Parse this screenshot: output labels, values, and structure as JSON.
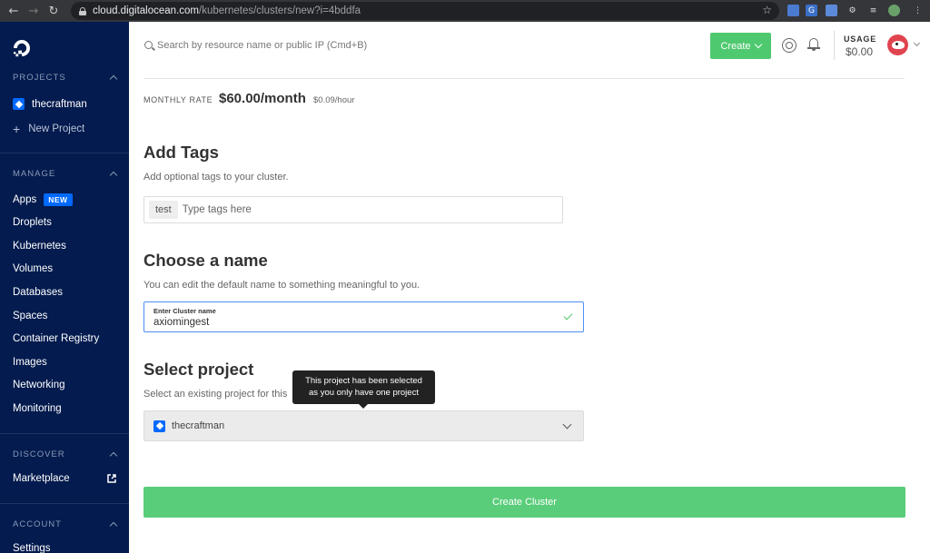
{
  "browser": {
    "url_host": "cloud.digitalocean.com",
    "url_path": "/kubernetes/clusters/new?i=4bddfa"
  },
  "sidebar": {
    "projects_header": "PROJECTS",
    "project_name": "thecraftman",
    "new_project": "New Project",
    "manage_header": "MANAGE",
    "items": [
      "Apps",
      "Droplets",
      "Kubernetes",
      "Volumes",
      "Databases",
      "Spaces",
      "Container Registry",
      "Images",
      "Networking",
      "Monitoring"
    ],
    "new_badge": "NEW",
    "discover_header": "DISCOVER",
    "marketplace": "Marketplace",
    "account_header": "ACCOUNT",
    "settings": "Settings"
  },
  "header": {
    "search_placeholder": "Search by resource name or public IP (Cmd+B)",
    "create_label": "Create",
    "usage_label": "USAGE",
    "usage_value": "$0.00"
  },
  "main": {
    "rate_label": "MONTHLY RATE",
    "rate_value": "$60.00/month",
    "rate_hour": "$0.09/hour",
    "tags_title": "Add Tags",
    "tags_sub": "Add optional tags to your cluster.",
    "tag_chip": "test",
    "tags_placeholder": "Type tags here",
    "name_title": "Choose a name",
    "name_sub": "You can edit the default name to something meaningful to you.",
    "name_label": "Enter Cluster name",
    "name_value": "axiomingest",
    "project_title": "Select project",
    "project_sub": "Select an existing project for this",
    "tooltip_line1": "This project has been selected",
    "tooltip_line2": "as you only have one project",
    "project_value": "thecraftman",
    "create_cluster": "Create Cluster"
  },
  "colors": {
    "sidebar_bg": "#031b4e",
    "accent_green": "#4fc96f",
    "accent_blue": "#0069ff"
  }
}
